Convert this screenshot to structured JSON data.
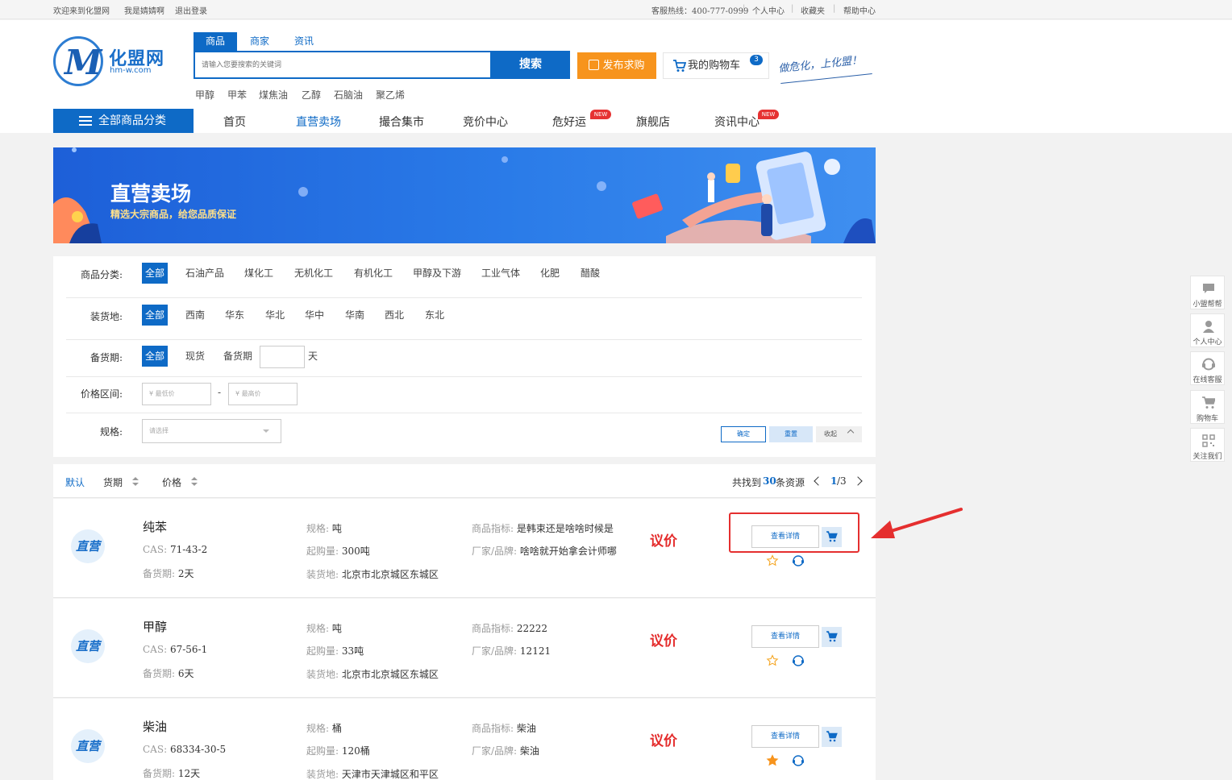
{
  "topbar": {
    "welcome": "欢迎来到化盟网",
    "user": "我是婧婧啊",
    "logout": "退出登录",
    "hotline": "客服热线：400-777-0999",
    "personal_center": "个人中心",
    "favorites": "收藏夹",
    "help": "帮助中心"
  },
  "logo": {
    "cn": "化盟网",
    "en": "hm-w.com"
  },
  "search": {
    "tabs": [
      "商品",
      "商家",
      "资讯"
    ],
    "placeholder": "请输入您要搜索的关键词",
    "button": "搜索",
    "hotwords": [
      "甲醇",
      "甲苯",
      "煤焦油",
      "乙醇",
      "石脑油",
      "聚乙烯"
    ]
  },
  "header": {
    "publish": "发布求购",
    "cart": "我的购物车",
    "cart_count": "3",
    "slogan": "做危化，上化盟！"
  },
  "nav": {
    "all_categories": "全部商品分类",
    "items": [
      "首页",
      "直营卖场",
      "撮合集市",
      "竞价中心",
      "危好运",
      "旗舰店",
      "资讯中心"
    ],
    "new_badge": "NEW"
  },
  "banner": {
    "title": "直营卖场",
    "subtitle": "精选大宗商品，给您品质保证"
  },
  "filter": {
    "category_label": "商品分类:",
    "categories": [
      "全部",
      "石油产品",
      "煤化工",
      "无机化工",
      "有机化工",
      "甲醇及下游",
      "工业气体",
      "化肥",
      "醋酸"
    ],
    "location_label": "装货地:",
    "locations": [
      "全部",
      "西南",
      "华东",
      "华北",
      "华中",
      "华南",
      "西北",
      "东北"
    ],
    "stock_label": "备货期:",
    "stock": [
      "全部",
      "现货",
      "备货期"
    ],
    "stock_unit": "天",
    "price_label": "价格区间:",
    "price_min_placeholder": "¥ 最低价",
    "price_max_placeholder": "¥ 最高价",
    "price_dash": "-",
    "spec_label": "规格:",
    "spec_placeholder": "请选择",
    "confirm": "确定",
    "reset": "重置",
    "collapse": "收起"
  },
  "list": {
    "sort_default": "默认",
    "sort_stock": "货期",
    "sort_price": "价格",
    "total_prefix": "共找到",
    "total": "30",
    "total_suffix": "条资源",
    "page": "1",
    "pages": "/3",
    "badge": "直营",
    "spec_key": "规格:",
    "min_key": "起购量:",
    "loc_key": "装货地:",
    "index_key": "商品指标:",
    "brand_key": "厂家/品牌:",
    "cas_key": "CAS:",
    "stock_key": "备货期:",
    "detail_btn": "查看详情",
    "rows": [
      {
        "name": "纯苯",
        "cas": "71-43-2",
        "stock": "2天",
        "spec": "吨",
        "min": "300吨",
        "loc": "北京市北京城区东城区",
        "index": "是韩束还是啥啥时候是",
        "brand": "啥啥就开始拿会计师哪",
        "price": "议价",
        "starred": false
      },
      {
        "name": "甲醇",
        "cas": "67-56-1",
        "stock": "6天",
        "spec": "吨",
        "min": "33吨",
        "loc": "北京市北京城区东城区",
        "index": "22222",
        "brand": "12121",
        "price": "议价",
        "starred": false
      },
      {
        "name": "柴油",
        "cas": "68334-30-5",
        "stock": "12天",
        "spec": "桶",
        "min": "120桶",
        "loc": "天津市天津城区和平区",
        "index": "柴油",
        "brand": "柴油",
        "price": "议价",
        "starred": true
      }
    ]
  },
  "side": [
    "小盟帮帮",
    "个人中心",
    "在线客服",
    "购物车",
    "关注我们"
  ],
  "colors": {
    "brand": "#0e6ac6",
    "price": "#e42b2b",
    "highlight": "#e52f2f",
    "publish": "#f7941d"
  }
}
